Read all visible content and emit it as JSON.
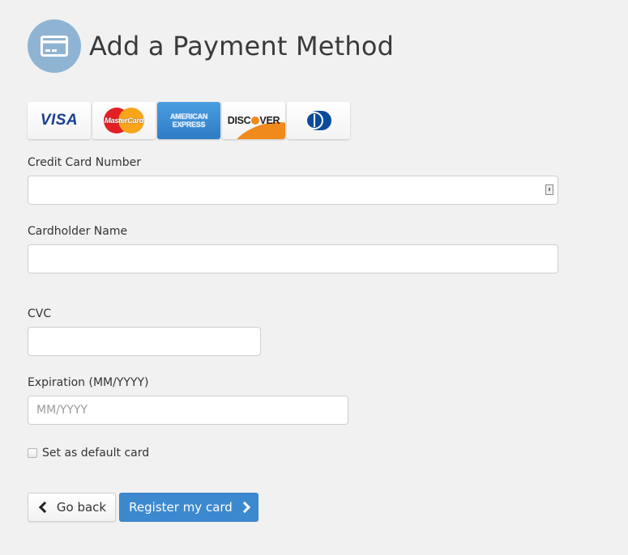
{
  "header": {
    "icon": "credit-card-icon",
    "title": "Add a Payment Method",
    "icon_bg_color": "#8fb4d3"
  },
  "card_brands": [
    {
      "name": "visa",
      "label": "VISA"
    },
    {
      "name": "mastercard",
      "label": "MasterCard"
    },
    {
      "name": "american-express",
      "label_line1": "AMERICAN",
      "label_line2": "EXPRESS"
    },
    {
      "name": "discover",
      "label_pre": "DISC",
      "label_post": "VER"
    },
    {
      "name": "diners-club",
      "label": ""
    }
  ],
  "form": {
    "card_number": {
      "label": "Credit Card Number",
      "value": "",
      "placeholder": "",
      "icon": "autofill-contact-icon"
    },
    "cardholder_name": {
      "label": "Cardholder Name",
      "value": "",
      "placeholder": ""
    },
    "cvc": {
      "label": "CVC",
      "value": "",
      "placeholder": ""
    },
    "expiration": {
      "label": "Expiration (MM/YYYY)",
      "value": "",
      "placeholder": "MM/YYYY"
    },
    "default_card": {
      "label": "Set as default card",
      "checked": false
    }
  },
  "actions": {
    "back_label": "Go back",
    "back_icon": "chevron-left-icon",
    "register_label": "Register my card",
    "register_icon": "chevron-right-icon",
    "primary_color": "#3d89cf"
  }
}
